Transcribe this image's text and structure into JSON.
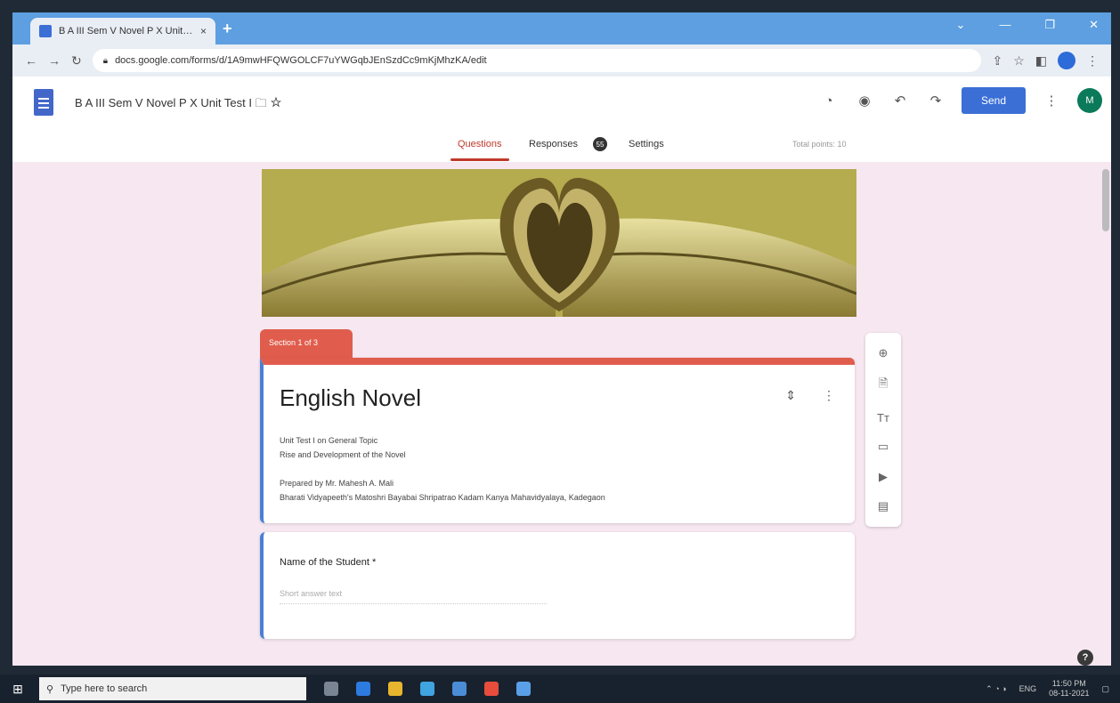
{
  "browser": {
    "tab_title": "B A III Sem V Novel P X Unit Test I",
    "tab_close": "×",
    "new_tab": "+",
    "url": "docs.google.com/forms/d/1A9mwHFQWGOLCF7uYWGqbJEnSzdCc9mKjMhzKA/edit"
  },
  "header": {
    "form_title": "B A III Sem V Novel P X Unit Test I",
    "send_label": "Send",
    "avatar_initials": "M"
  },
  "tabs": {
    "questions": "Questions",
    "responses": "Responses",
    "responses_count": "55",
    "settings": "Settings",
    "total_points": "Total points: 10"
  },
  "section": {
    "tag": "Section 1 of 3",
    "title": "English Novel",
    "line1": "Unit Test I on General Topic",
    "line2": "Rise and Development of the Novel",
    "line3": "Prepared by Mr. Mahesh A. Mali",
    "line4": "Bharati Vidyapeeth's Matoshri Bayabai Shripatrao Kadam Kanya Mahavidyalaya, Kadegaon"
  },
  "question1": {
    "label": "Name of the Student *",
    "placeholder": "Short answer text"
  },
  "taskbar": {
    "search_placeholder": "Type here to search",
    "time": "11:50 PM",
    "date": "08-11-2021",
    "lang": "ENG"
  },
  "colors": {
    "accent": "#3b6fd6",
    "section_red": "#e05d4d",
    "canvas": "#f6e7f1"
  }
}
